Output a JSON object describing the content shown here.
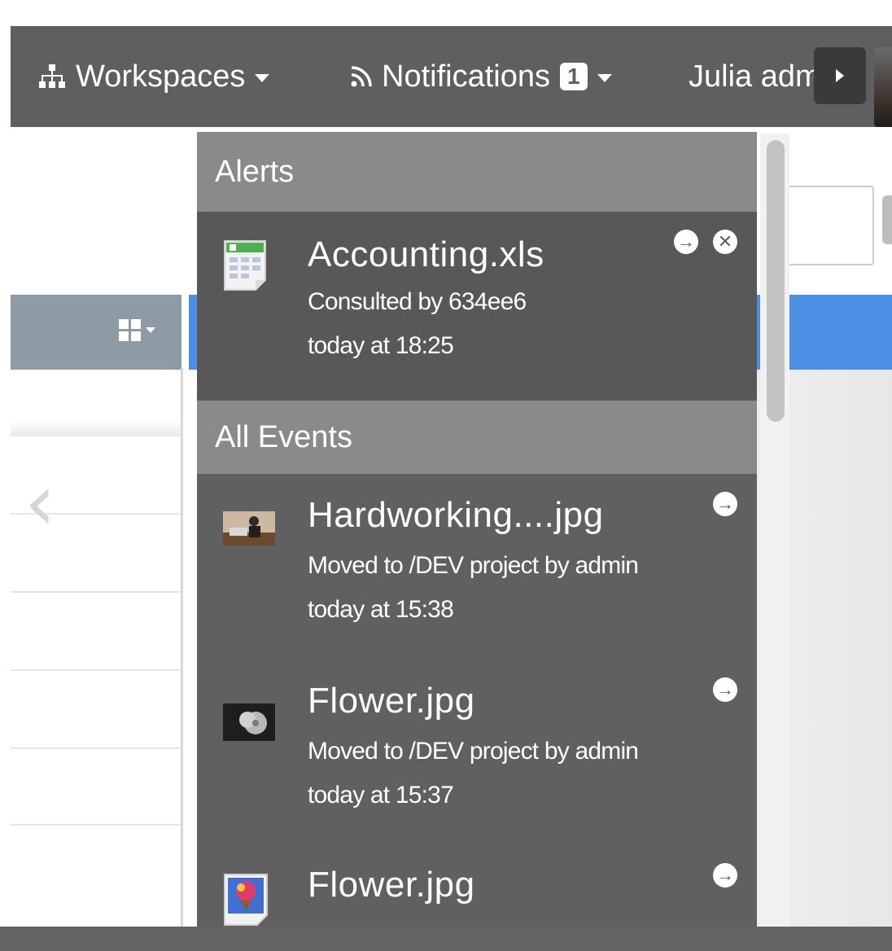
{
  "navbar": {
    "workspaces_label": "Workspaces",
    "notifications_label": "Notifications",
    "notifications_count": "1",
    "user_label": "Julia adm"
  },
  "dropdown": {
    "alerts_header": "Alerts",
    "all_events_header": "All Events",
    "alerts": [
      {
        "title": "Accounting.xls",
        "line1": "Consulted by 634ee6",
        "line2": "today at 18:25",
        "thumbnail": "spreadsheet-file-icon"
      }
    ],
    "events": [
      {
        "title": "Hardworking....jpg",
        "line1": "Moved to /DEV project by admin",
        "line2": "today at 15:38",
        "thumbnail": "photo-thumbnail"
      },
      {
        "title": "Flower.jpg",
        "line1": "Moved to /DEV project by admin",
        "line2": "today at 15:37",
        "thumbnail": "photo-thumbnail"
      },
      {
        "title": "Flower.jpg",
        "thumbnail": "image-file-icon"
      }
    ]
  },
  "icons": {
    "workspaces": "sitemap-icon",
    "notifications": "rss-icon",
    "go": "arrow-right-circle-icon",
    "dismiss": "close-circle-icon",
    "view": "grid-view-icon",
    "back": "chevron-left-icon"
  },
  "colors": {
    "navbar": "#5f5f5f",
    "dropdown": "#606060",
    "section_header": "#8a8a8a",
    "accent_blue": "#4a8fe3"
  }
}
